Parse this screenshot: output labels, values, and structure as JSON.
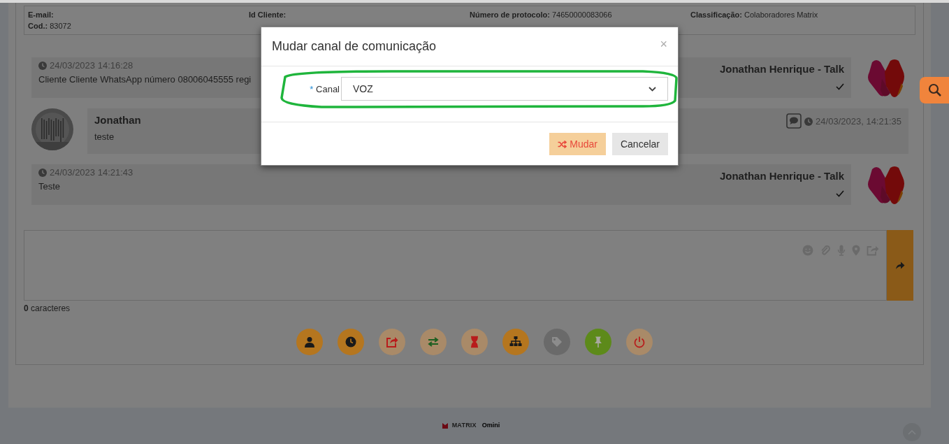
{
  "customer_info": {
    "fields": [
      {
        "label": "E-mail:"
      },
      {
        "label": "Id Cliente:"
      },
      {
        "label": "Número de protocolo:",
        "value": "74650000083066"
      },
      {
        "label": "Classificação:",
        "value": "Colaboradores Matrix"
      },
      {
        "label": "Cod.:",
        "value": "83072"
      }
    ]
  },
  "messages": [
    {
      "kind": "agent",
      "time": "24/03/2023 14:16:28",
      "text": "Cliente Cliente WhatsApp número 08006045555 regi",
      "author": "Jonathan Henrique - Talk"
    },
    {
      "kind": "client",
      "author": "Jonathan",
      "text": "teste",
      "time": "24/03/2023, 14:21:35"
    },
    {
      "kind": "agent",
      "time": "24/03/2023 14:21:43",
      "text": "Teste",
      "author": "Jonathan Henrique - Talk"
    }
  ],
  "composer": {
    "count": "0",
    "count_label": "caracteres"
  },
  "footer": {
    "brand": "MATRIX",
    "product": "Omini"
  },
  "modal": {
    "title": "Mudar canal de comunicação",
    "close": "×",
    "field": {
      "label": "Canal",
      "required": true,
      "required_mark": "*",
      "value": "VOZ"
    },
    "buttons": [
      {
        "label": "Mudar",
        "kind": "primary"
      },
      {
        "label": "Cancelar",
        "kind": "default"
      }
    ]
  }
}
